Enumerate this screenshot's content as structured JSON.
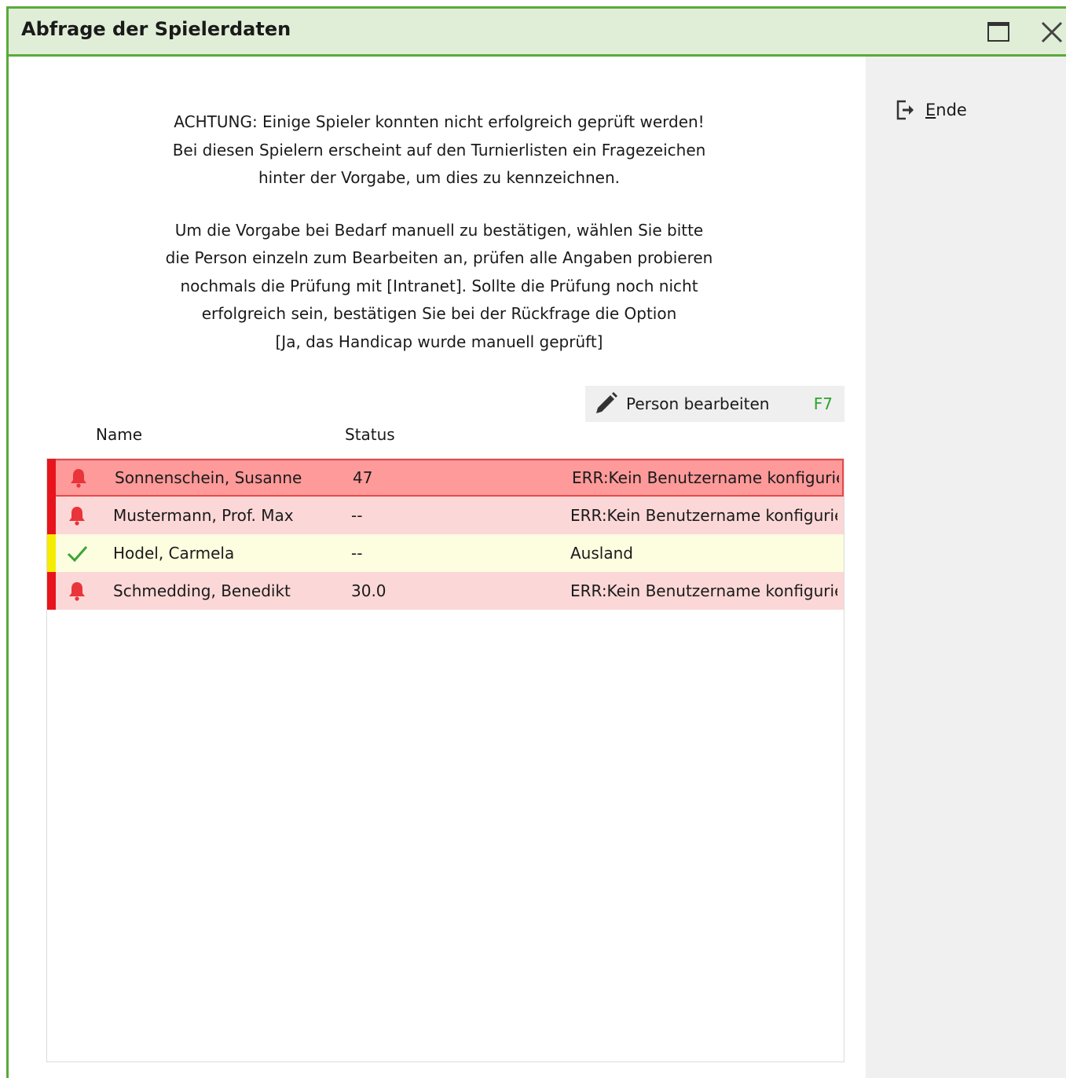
{
  "window": {
    "title": "Abfrage der Spielerdaten"
  },
  "sidebar": {
    "ende_label": "Ende",
    "ende_icon": "exit-icon"
  },
  "message": {
    "paragraph1": [
      "ACHTUNG: Einige Spieler konnten nicht erfolgreich geprüft werden!",
      "Bei diesen Spielern erscheint auf den Turnierlisten ein Fragezeichen",
      "hinter der Vorgabe, um dies zu kennzeichnen."
    ],
    "paragraph2": [
      "Um die Vorgabe bei Bedarf manuell zu bestätigen, wählen Sie bitte",
      "die Person einzeln zum Bearbeiten an, prüfen alle Angaben probieren",
      "nochmals die Prüfung mit [Intranet]. Sollte die Prüfung noch nicht",
      "erfolgreich sein, bestätigen Sie bei der Rückfrage die Option",
      "[Ja, das Handicap wurde manuell geprüft]"
    ]
  },
  "toolbar": {
    "edit_label": "Person bearbeiten",
    "edit_shortcut": "F7",
    "edit_icon": "pencil-icon"
  },
  "table": {
    "columns": [
      "Name",
      "Status"
    ],
    "rows": [
      {
        "name": "Sonnenschein, Susanne",
        "value": "47",
        "message": "ERR:Kein Benutzername konfiguriert",
        "status": "error",
        "icon": "bell-icon",
        "selected": true
      },
      {
        "name": "Mustermann, Prof. Max",
        "value": "--",
        "message": "ERR:Kein Benutzername konfiguriert",
        "status": "error",
        "icon": "bell-icon",
        "selected": false
      },
      {
        "name": "Hodel, Carmela",
        "value": "--",
        "message": "Ausland",
        "status": "ok",
        "icon": "checkmark-icon",
        "selected": false
      },
      {
        "name": "Schmedding, Benedikt",
        "value": "30.0",
        "message": "ERR:Kein Benutzername konfiguriert",
        "status": "error",
        "icon": "bell-icon",
        "selected": false
      }
    ]
  },
  "colors": {
    "accent_green": "#5aaa3c",
    "title_bg": "#e0eed8",
    "error_stripe": "#e8141c",
    "error_row_bg": "#fcd7d7",
    "error_row_selected_bg": "#ff9a9a",
    "ok_stripe": "#f5ec00",
    "ok_row_bg": "#fdfde0",
    "bell_red": "#e8343a",
    "check_green": "#3aa535",
    "shortcut_green": "#2aa52a"
  }
}
